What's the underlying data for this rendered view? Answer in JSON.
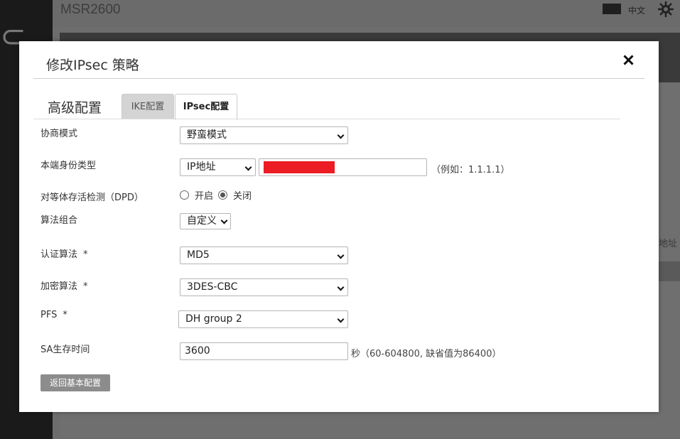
{
  "background": {
    "app_title": "MSR2600",
    "language": "中文",
    "partial_label": "地址"
  },
  "modal": {
    "title": "修改IPsec 策略",
    "section_title": "高级配置",
    "tabs": [
      {
        "label": "IKE配置",
        "active": false
      },
      {
        "label": "IPsec配置",
        "active": true
      }
    ],
    "fields": {
      "negotiation_mode": {
        "label": "协商模式",
        "value": "野蛮模式"
      },
      "local_id_type": {
        "label": "本端身份类型",
        "type_value": "IP地址",
        "id_value": "",
        "hint": "（例如：1.1.1.1）"
      },
      "dpd": {
        "label": "对等体存活检测（DPD）",
        "options": [
          "开启",
          "关闭"
        ],
        "selected": "关闭"
      },
      "algorithm_suite": {
        "label": "算法组合",
        "value": "自定义"
      },
      "auth_algorithm": {
        "label": "认证算法",
        "required": "*",
        "value": "MD5"
      },
      "encryption_algorithm": {
        "label": "加密算法",
        "required": "*",
        "value": "3DES-CBC"
      },
      "pfs": {
        "label": "PFS",
        "required": "*",
        "value": "DH group 2"
      },
      "sa_lifetime": {
        "label": "SA生存时间",
        "value": "3600",
        "hint": "秒（60-604800, 缺省值为86400）"
      }
    },
    "back_button": "返回基本配置"
  },
  "colors": {
    "redaction": "#ec1c24",
    "overlay": "#6d6d6d",
    "button": "#8c8c8c"
  }
}
